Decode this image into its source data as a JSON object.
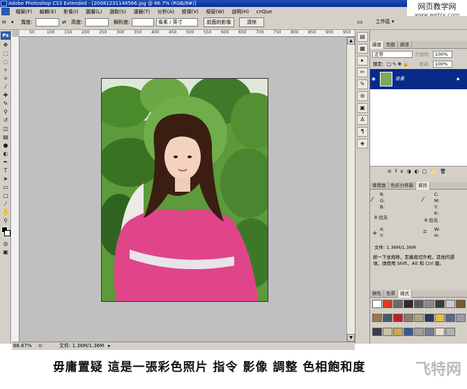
{
  "window": {
    "title": "Adobe Photoshop CS3 Extended - [20081231148566.jpg @ 66.7% (RGB/8#)]"
  },
  "site_watermark": {
    "line1": "网页教学网",
    "line2": "www.webjx.com"
  },
  "menu": [
    "檔案(F)",
    "編輯(E)",
    "影像(I)",
    "圖層(L)",
    "選取(S)",
    "濾鏡(T)",
    "分析(A)",
    "檢視(V)",
    "視窗(W)",
    "說明(H)",
    "cnQue"
  ],
  "options_bar": {
    "width_label": "寬度:",
    "height_label": "高度:",
    "resolution_label": "解析度:",
    "unit_value": "像素 / 英寸",
    "front_image_button": "前面的影像",
    "clear_button": "清除",
    "workspace_label": "工作區 ▾"
  },
  "toolbox": {
    "ps_label": "Ps"
  },
  "document": {
    "zoom": "66.67%",
    "doc_size": "文件: 1.36M/1.36M",
    "ruler_top": [
      "50",
      "100",
      "150",
      "200",
      "250",
      "300",
      "350",
      "400",
      "450",
      "500",
      "550",
      "600",
      "650",
      "700",
      "750",
      "800",
      "850",
      "900",
      "950"
    ]
  },
  "layers_panel": {
    "tabs": [
      "圖層",
      "色版",
      "路徑"
    ],
    "blend_mode": "正常",
    "opacity_label": "不透明:",
    "opacity_value": "100%",
    "lock_label": "鎖定:",
    "fill_label": "填滿:",
    "fill_value": "100%",
    "layer_name": "背景"
  },
  "info_panel": {
    "tabs": [
      "導覽器",
      "色彩分佈圖",
      "資訊"
    ],
    "r": "R:",
    "g": "G:",
    "b": "B:",
    "c": "C:",
    "m": "M:",
    "y": "Y:",
    "k": "K:",
    "bit_left": "8 位元",
    "bit_right": "8 位元",
    "x": "X:",
    "yc": "Y:",
    "w": "W:",
    "h": "H:",
    "doc_size": "文件: 1.36M/1.36M",
    "hint_line1": "按一下並拖移，定義裁切外框。其他的選",
    "hint_line2": "項，請使用 Shift、Alt 和 Ctrl 鍵。"
  },
  "styles_panel": {
    "tabs": [
      "顏色",
      "色票",
      "樣式"
    ]
  },
  "caption": {
    "text": "毋庸置疑 這是一張彩色照片 指令 影像 調整 色相飽和度",
    "watermark": "飞特网"
  },
  "colors": {
    "chrome": "#d4d0c8",
    "title_blue": "#1f4fb8",
    "layer_selected": "#0a2a8a",
    "dress_pink": "#e0458a",
    "leaf_green": "#3f7a2a"
  },
  "swatches": [
    "#ffffff",
    "#e03a1f",
    "#6a6a6a",
    "#2a2a2a",
    "#5a5a5a",
    "#8a8a8a",
    "#3a3a3a",
    "#c8c8c8",
    "#7a5a2a",
    "#9a7a4a",
    "#4a5a6a",
    "#c02020",
    "#8a7a6a",
    "#b0a090",
    "#2a3a5a",
    "#e0c040",
    "#5a6a8a",
    "#9a9aaa",
    "#3a3a4a",
    "#d0c0a0",
    "#caa85a",
    "#3a5a8a",
    "#a0a0a0",
    "#7a7a9a",
    "#e8e0d0",
    "#b0b0b0"
  ]
}
